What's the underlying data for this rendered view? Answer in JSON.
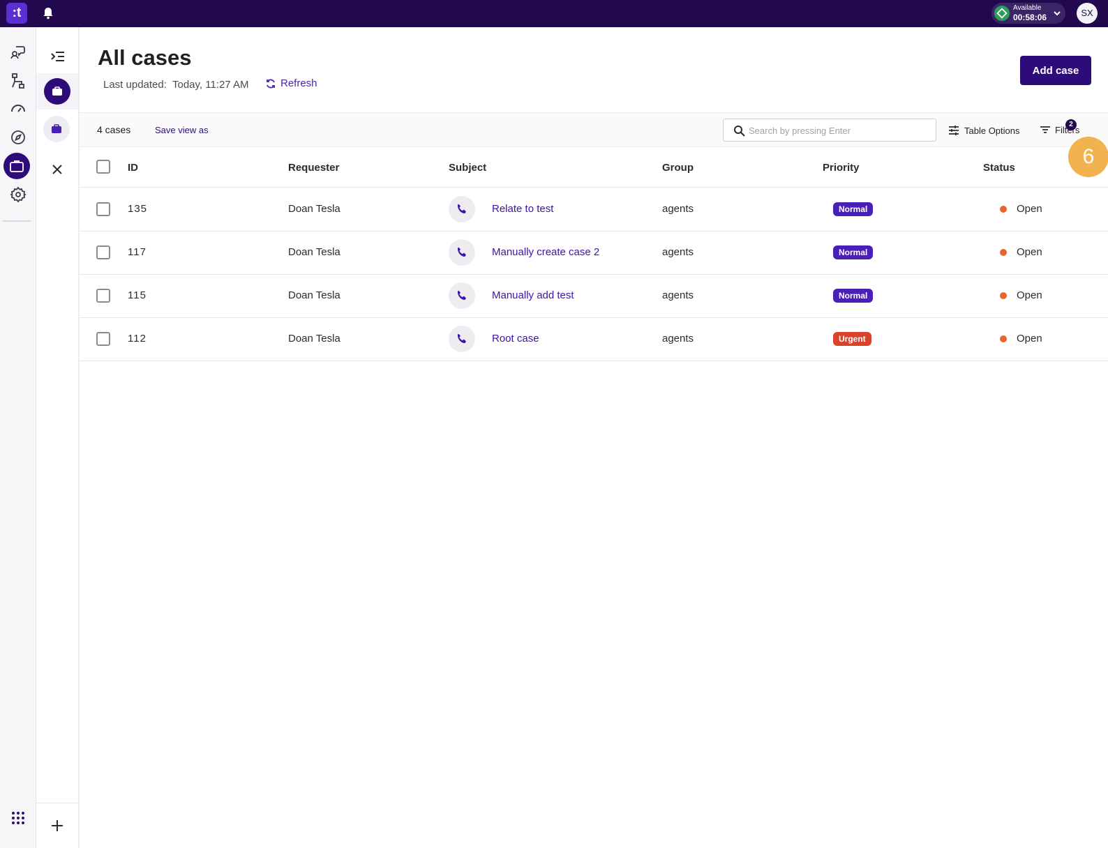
{
  "topbar": {
    "logo_text": ":t",
    "status_label": "Available",
    "status_timer": "00:58:06",
    "avatar_initials": "SX"
  },
  "page": {
    "title": "All cases",
    "last_updated": "Last updated:  Today, 11:27 AM",
    "refresh_label": "Refresh",
    "add_case_label": "Add case"
  },
  "toolbar": {
    "case_count": "4 cases",
    "save_view_label": "Save view as",
    "search_placeholder": "Search by pressing Enter",
    "table_options_label": "Table Options",
    "filters_label": "Filters",
    "filters_count": "2"
  },
  "marker": "6",
  "table": {
    "columns": [
      "ID",
      "Requester",
      "Subject",
      "Group",
      "Priority",
      "Status"
    ],
    "rows": [
      {
        "id": "135",
        "requester": "Doan Tesla",
        "subject": "Relate to test",
        "group": "agents",
        "priority": "Normal",
        "status": "Open"
      },
      {
        "id": "117",
        "requester": "Doan Tesla",
        "subject": "Manually create case 2",
        "group": "agents",
        "priority": "Normal",
        "status": "Open"
      },
      {
        "id": "115",
        "requester": "Doan Tesla",
        "subject": "Manually add test",
        "group": "agents",
        "priority": "Normal",
        "status": "Open"
      },
      {
        "id": "112",
        "requester": "Doan Tesla",
        "subject": "Root case",
        "group": "agents",
        "priority": "Urgent",
        "status": "Open"
      }
    ]
  },
  "colors": {
    "brand": "#22094f",
    "accent": "#2d0c7a",
    "link": "#3d13a8",
    "normal_badge": "#4a1fb8",
    "urgent_badge": "#d9432b",
    "open_dot": "#e8642a",
    "marker": "#f2b24e"
  },
  "icons": [
    "logo-icon",
    "bell-icon",
    "chevron-down-icon",
    "conversations-icon",
    "flow-icon",
    "dashboard-gauge-icon",
    "compass-icon",
    "briefcase-icon",
    "gear-icon",
    "apps-grid-icon",
    "collapse-menu-icon",
    "close-icon",
    "plus-icon",
    "refresh-icon",
    "search-icon",
    "sliders-icon",
    "filter-icon",
    "phone-icon"
  ]
}
